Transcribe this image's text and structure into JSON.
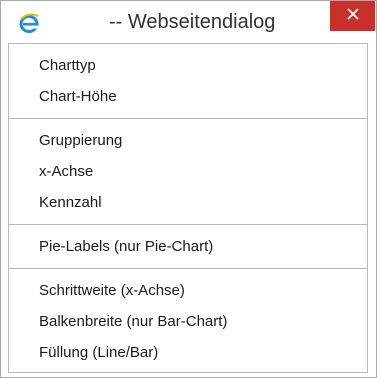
{
  "window": {
    "title": "-- Webseitendialog",
    "app_icon": "internet-explorer-icon",
    "close_icon": "close-icon",
    "close_color": "#c7302b"
  },
  "menu": {
    "groups": [
      {
        "items": [
          {
            "label": "Charttyp"
          },
          {
            "label": "Chart-Höhe"
          }
        ]
      },
      {
        "items": [
          {
            "label": "Gruppierung"
          },
          {
            "label": "x-Achse"
          },
          {
            "label": "Kennzahl"
          }
        ]
      },
      {
        "items": [
          {
            "label": "Pie-Labels (nur Pie-Chart)"
          }
        ]
      },
      {
        "items": [
          {
            "label": "Schrittweite (x-Achse)"
          },
          {
            "label": "Balkenbreite (nur Bar-Chart)"
          },
          {
            "label": "Füllung (Line/Bar)"
          }
        ]
      }
    ]
  }
}
